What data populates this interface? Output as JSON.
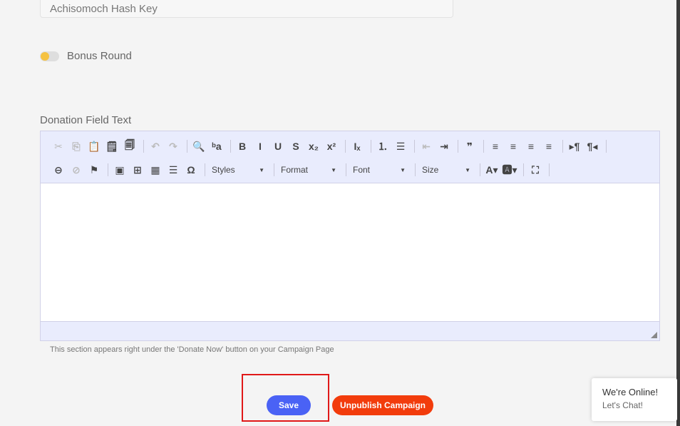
{
  "hash_field": {
    "value": "Achisomoch Hash Key"
  },
  "bonus_round": {
    "label": "Bonus Round",
    "enabled": false,
    "knob_color": "#f5c242"
  },
  "donation_field": {
    "label": "Donation Field Text"
  },
  "toolbar": {
    "row1": [
      {
        "icon": "cut-icon",
        "glyph": "✂",
        "disabled": true
      },
      {
        "icon": "copy-icon",
        "glyph": "⎘",
        "disabled": true
      },
      {
        "icon": "paste-icon",
        "glyph": "📋",
        "disabled": false
      },
      {
        "icon": "paste-text-icon",
        "glyph": "🗒",
        "disabled": false
      },
      {
        "icon": "paste-word-icon",
        "glyph": "🗐",
        "disabled": false
      },
      {
        "sep": true
      },
      {
        "icon": "undo-icon",
        "glyph": "↶",
        "disabled": true
      },
      {
        "icon": "redo-icon",
        "glyph": "↷",
        "disabled": true
      },
      {
        "sep": true
      },
      {
        "icon": "find-icon",
        "glyph": "🔍",
        "disabled": false
      },
      {
        "icon": "replace-icon",
        "glyph": "ᵇa",
        "disabled": false
      },
      {
        "sep": true
      },
      {
        "icon": "bold-icon",
        "glyph": "B",
        "disabled": false
      },
      {
        "icon": "italic-icon",
        "glyph": "I",
        "disabled": false
      },
      {
        "icon": "underline-icon",
        "glyph": "U",
        "disabled": false
      },
      {
        "icon": "strike-icon",
        "glyph": "S",
        "disabled": false
      },
      {
        "icon": "subscript-icon",
        "glyph": "x₂",
        "disabled": false
      },
      {
        "icon": "superscript-icon",
        "glyph": "x²",
        "disabled": false
      },
      {
        "sep": true
      },
      {
        "icon": "remove-format-icon",
        "glyph": "Iₓ",
        "disabled": false
      },
      {
        "sep": true
      },
      {
        "icon": "numbered-list-icon",
        "glyph": "⒈",
        "disabled": false
      },
      {
        "icon": "bulleted-list-icon",
        "glyph": "☰",
        "disabled": false
      },
      {
        "sep": true
      },
      {
        "icon": "outdent-icon",
        "glyph": "⇤",
        "disabled": true
      },
      {
        "icon": "indent-icon",
        "glyph": "⇥",
        "disabled": false
      },
      {
        "sep": true
      },
      {
        "icon": "blockquote-icon",
        "glyph": "❞",
        "disabled": false
      },
      {
        "sep": true
      },
      {
        "icon": "align-left-icon",
        "glyph": "≡",
        "disabled": false
      },
      {
        "icon": "align-center-icon",
        "glyph": "≡",
        "disabled": false
      },
      {
        "icon": "align-right-icon",
        "glyph": "≡",
        "disabled": false
      },
      {
        "icon": "justify-icon",
        "glyph": "≡",
        "disabled": false
      },
      {
        "sep": true
      },
      {
        "icon": "ltr-icon",
        "glyph": "▸¶",
        "disabled": false
      },
      {
        "icon": "rtl-icon",
        "glyph": "¶◂",
        "disabled": false
      },
      {
        "sep": true
      }
    ],
    "row2_icons_a": [
      {
        "icon": "link-icon",
        "glyph": "⊖",
        "disabled": false
      },
      {
        "icon": "unlink-icon",
        "glyph": "⊘",
        "disabled": true
      },
      {
        "icon": "anchor-flag-icon",
        "glyph": "⚑",
        "disabled": false
      },
      {
        "sep": true
      },
      {
        "icon": "image-icon",
        "glyph": "▣",
        "disabled": false
      },
      {
        "icon": "insert-media-icon",
        "glyph": "⊞",
        "disabled": false
      },
      {
        "icon": "table-icon",
        "glyph": "▦",
        "disabled": false
      },
      {
        "icon": "horizontal-line-icon",
        "glyph": "☰",
        "disabled": false
      },
      {
        "icon": "special-char-icon",
        "glyph": "Ω",
        "disabled": false
      },
      {
        "sep": true
      }
    ],
    "combos": {
      "styles": "Styles",
      "format": "Format",
      "font": "Font",
      "size": "Size"
    },
    "row2_icons_b": [
      {
        "icon": "text-color-icon",
        "glyph": "A▾",
        "disabled": false
      },
      {
        "icon": "bg-color-icon",
        "glyph": "🅰▾",
        "disabled": false
      },
      {
        "sep": true
      },
      {
        "icon": "maximize-icon",
        "glyph": "⛶",
        "disabled": false
      },
      {
        "sep": true
      }
    ]
  },
  "hint_text": "This section appears right under the 'Donate Now' button on your Campaign Page",
  "actions": {
    "save_label": "Save",
    "unpublish_label": "Unpublish Campaign"
  },
  "colors": {
    "save": "#4a62f5",
    "unpublish": "#f23c0c",
    "highlight": "#e01818"
  },
  "chat": {
    "title": "We're Online!",
    "subtitle": "Let's Chat!"
  }
}
